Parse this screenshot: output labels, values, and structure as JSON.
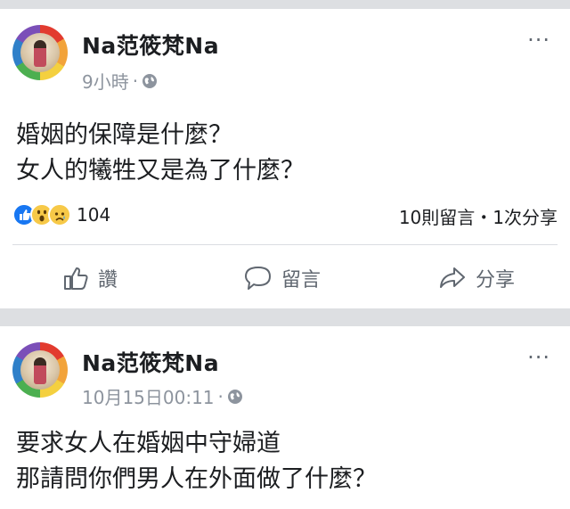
{
  "posts": [
    {
      "author": "Na范筱梵Na",
      "time": "9小時",
      "dot": "·",
      "lines": [
        "婚姻的保障是什麼？",
        "女人的犧牲又是為了什麼？"
      ],
      "reaction_count": "104",
      "counts_text": "10則留言・1次分享",
      "more": "···",
      "actions": {
        "like": "讚",
        "comment": "留言",
        "share": "分享"
      }
    },
    {
      "author": "Na范筱梵Na",
      "time": "10月15日00:11",
      "dot": "·",
      "lines": [
        "要求女人在婚姻中守婦道",
        "那請問你們男人在外面做了什麼？"
      ],
      "more": "···"
    }
  ],
  "colors": {
    "like_blue": "#1877f2",
    "reaction_yellow": "#f7c948",
    "meta_grey": "#8d949e"
  },
  "icons": [
    "globe-icon",
    "more-icon",
    "like-icon",
    "comment-icon",
    "share-icon"
  ]
}
